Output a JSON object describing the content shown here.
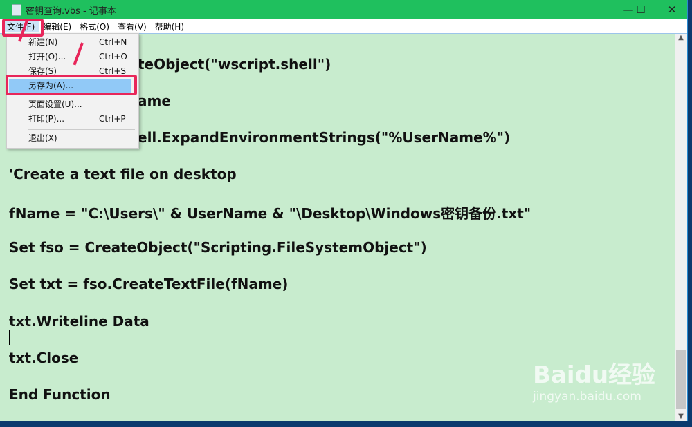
{
  "window": {
    "title": "密钥查询.vbs - 记事本",
    "controls": [
      "—",
      "☐",
      "✕"
    ]
  },
  "menubar": [
    "文件(F)",
    "编辑(E)",
    "格式(O)",
    "查看(V)",
    "帮助(H)"
  ],
  "file_menu": [
    {
      "label": "新建(N)",
      "shortcut": "Ctrl+N"
    },
    {
      "label": "打开(O)...",
      "shortcut": "Ctrl+O"
    },
    {
      "label": "保存(S)",
      "shortcut": "Ctrl+S"
    },
    {
      "label": "另存为(A)...",
      "shortcut": "",
      "highlighted": true
    },
    {
      "label": "页面设置(U)...",
      "shortcut": ""
    },
    {
      "label": "打印(P)...",
      "shortcut": "Ctrl+P"
    },
    {
      "label": "退出(X)",
      "shortcut": ""
    }
  ],
  "editor_lines": [
    "teObject(\"wscript.shell\")",
    "ame",
    "ell.ExpandEnvironmentStrings(\"%UserName%\")",
    "'Create a text file on desktop",
    "fName = \"C:\\Users\\\" & UserName & \"\\Desktop\\Windows密钥备份.txt\"",
    "Set fso = CreateObject(\"Scripting.FileSystemObject\")",
    "Set txt = fso.CreateTextFile(fName)",
    "txt.Writeline Data",
    "txt.Close",
    "End Function"
  ],
  "watermark": {
    "brand": "Baidu经验",
    "url": "jingyan.baidu.com"
  },
  "colors": {
    "titlebar": "#1fc05e",
    "editor_bg": "#c8ecce",
    "highlight": "#e8265a",
    "selection": "#91c9f7"
  }
}
